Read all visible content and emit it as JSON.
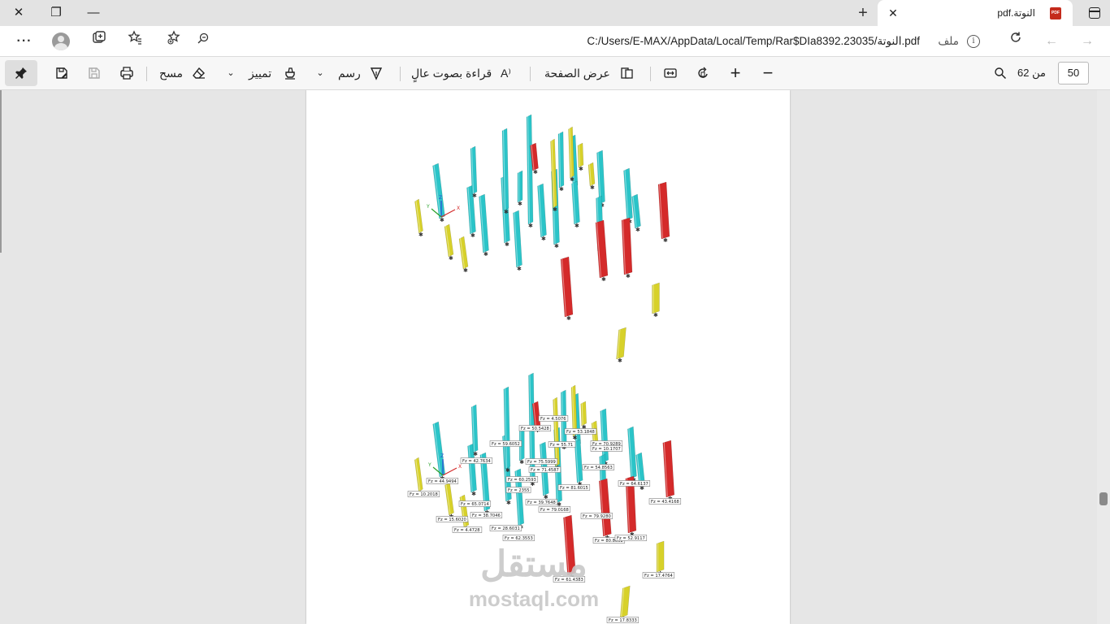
{
  "browser": {
    "tab": {
      "title": "النوتة.pdf",
      "pdf_badge": "PDF"
    },
    "new_tab_label": "+",
    "address": {
      "url": "C:/Users/E-MAX/AppData/Local/Temp/Rar$DIa8392.23035/النوتة.pdf",
      "scheme_label": "ملف"
    },
    "menu_label": "···"
  },
  "pdf_toolbar": {
    "page_current": "50",
    "page_total": "من 62",
    "zoom_out": "−",
    "zoom_in": "+",
    "page_view_label": "عرض الصفحة",
    "read_aloud_label": "قراءة بصوت عالٍ",
    "draw_label": "رسم",
    "highlight_label": "تمييز",
    "erase_label": "مسح"
  },
  "document": {
    "watermark_arabic": "مستقل",
    "watermark_latin": "mostaql.com",
    "model_labels": [
      "Fz = 4.5076",
      "Fz = 50.5428",
      "Fz = 53.1848",
      "Fz = 59.6052",
      "Fz = 55.71",
      "Fz = 70.9289",
      "Fz = 10.1707",
      "Fz = 42.7634",
      "Fz = 75.5999",
      "Fz = 71.4587",
      "Fz = 54.8563",
      "Fz = 44.9494",
      "Fz = 60.2593",
      "Fz = 64.6137",
      "Fz = 10.2018",
      "Fz = 65.0714",
      "Fz = 2355",
      "Fz = 81.6015",
      "Fz = 43.4168",
      "Fz = 39.7648",
      "Fz = 79.0168",
      "Fz = 15.6020",
      "Fz = 38.7046",
      "Fz = 79.9280",
      "Fz = 4.4728",
      "Fz = 28.6031",
      "Fz = 62.3553",
      "Fz = 80.8652",
      "Fz = 52.9117",
      "Fz = 17.4764",
      "Fz = 61.4383",
      "Fz = 17.8333"
    ]
  },
  "colors": {
    "column_cyan": "#2bc4c8",
    "column_yellow": "#d7d12a",
    "column_red": "#d42a2a",
    "accent": "#0f6cbd"
  }
}
